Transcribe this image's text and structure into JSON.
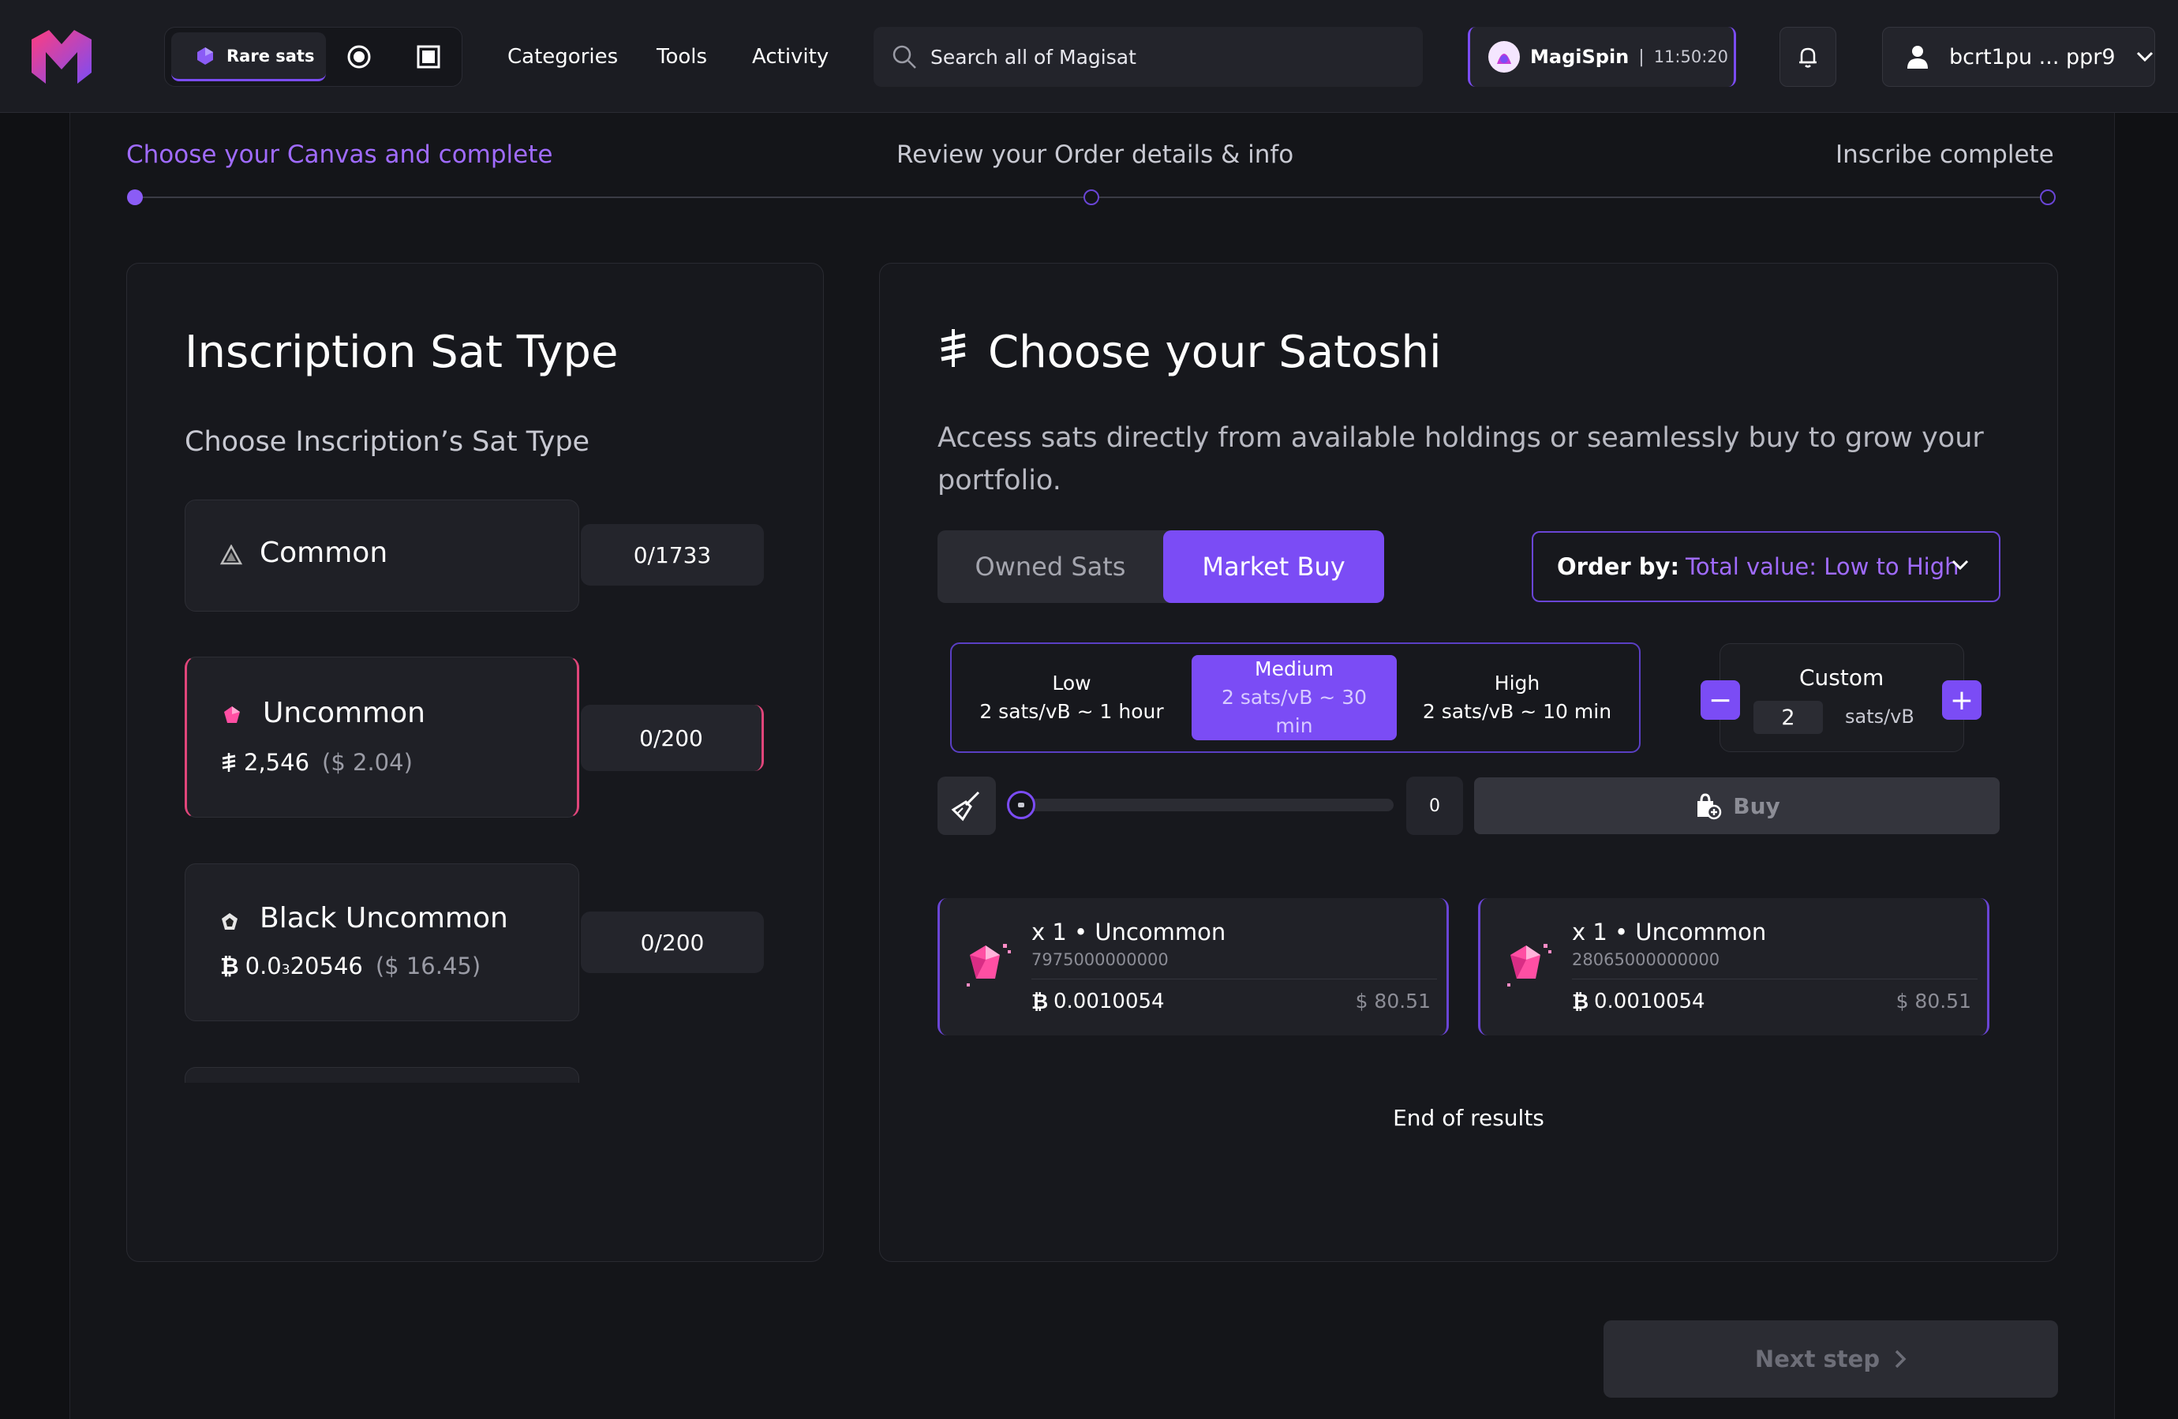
{
  "header": {
    "logo": "magisat-logo",
    "modes": {
      "active_label": "Rare sats",
      "icons": [
        "rare-sats-icon",
        "circle-mode-icon",
        "square-mode-icon"
      ]
    },
    "nav": [
      "Categories",
      "Tools",
      "Activity"
    ],
    "search": {
      "placeholder": "Search all of Magisat"
    },
    "magispin": {
      "label": "MagiSpin",
      "separator": "|",
      "timer": "11:50:20"
    },
    "wallet": {
      "address": "bcrt1pu ... ppr9"
    }
  },
  "stepper": {
    "steps": [
      "Choose your Canvas and complete",
      "Review your Order details & info",
      "Inscribe complete"
    ],
    "active_index": 0,
    "accent": "#a06bff"
  },
  "left_panel": {
    "title": "Inscription Sat Type",
    "subtitle": "Choose Inscription’s Sat Type",
    "sat_types": [
      {
        "name": "Common",
        "count": "0/1733",
        "icon": "common-triangle-icon"
      },
      {
        "name": "Uncommon",
        "count": "0/200",
        "icon": "uncommon-gem-icon",
        "price_symbol": "sats-icon",
        "price": "2,546",
        "fiat": "($ 2.04)"
      },
      {
        "name": "Black Uncommon",
        "count": "0/200",
        "icon": "black-uncommon-gem-icon",
        "price_symbol": "₿",
        "price_prefix": "0.0",
        "price_sub": "3",
        "price_rest": "20546",
        "fiat": "($ 16.45)"
      }
    ]
  },
  "right_panel": {
    "title": "Choose your Satoshi",
    "description": "Access sats directly from available holdings or seamlessly buy to grow your portfolio.",
    "tabs": [
      "Owned Sats",
      "Market Buy"
    ],
    "active_tab": 1,
    "order_by": {
      "label": "Order by:",
      "value": "Total value: Low to High"
    },
    "fees": [
      {
        "name": "Low",
        "detail": "2 sats/vB ~ 1 hour"
      },
      {
        "name": "Medium",
        "detail": "2 sats/vB ~ 30 min"
      },
      {
        "name": "High",
        "detail": "2 sats/vB ~ 10 min"
      }
    ],
    "active_fee": 1,
    "custom": {
      "label": "Custom",
      "value": "2",
      "unit": "sats/vB",
      "minus": "−",
      "plus": "+"
    },
    "slider": {
      "value": "0",
      "fraction": 0
    },
    "buy_label": "Buy",
    "results": [
      {
        "title": "x 1 • Uncommon",
        "sat_number": "7975000000000",
        "btc": "0.0010054",
        "usd": "$ 80.51"
      },
      {
        "title": "x 1 • Uncommon",
        "sat_number": "28065000000000",
        "btc": "0.0010054",
        "usd": "$ 80.51"
      }
    ],
    "end_text": "End of results"
  },
  "footer": {
    "next_label": "Next step"
  },
  "colors": {
    "accent": "#7b4cf5",
    "accent_text": "#a06bff",
    "background": "#101114"
  }
}
